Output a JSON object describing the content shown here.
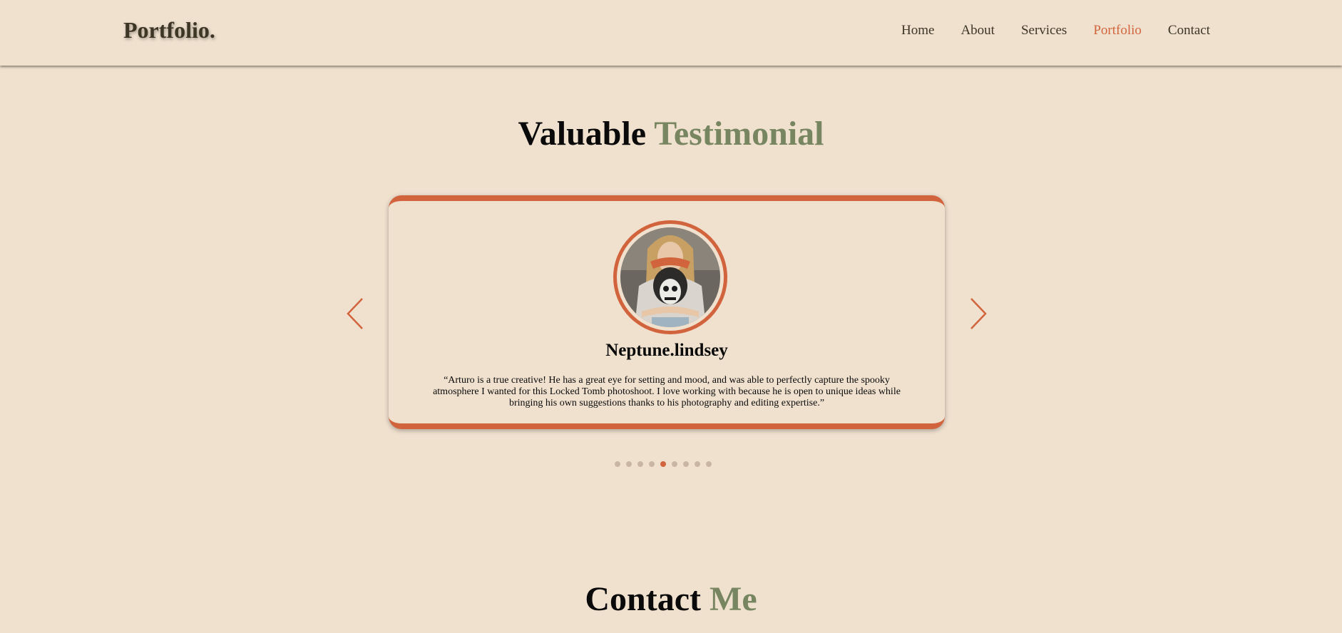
{
  "navbar": {
    "brand": "Portfolio.",
    "links": [
      {
        "label": "Home",
        "active": false
      },
      {
        "label": "About",
        "active": false
      },
      {
        "label": "Services",
        "active": false
      },
      {
        "label": "Portfolio",
        "active": true
      },
      {
        "label": "Contact",
        "active": false
      }
    ]
  },
  "testimonials": {
    "title_main": "Valuable",
    "title_accent": "Testimonial",
    "card": {
      "name": "Neptune.lindsey",
      "quote": "“Arturo is a true creative! He has a great eye for setting and mood, and was able to perfectly capture the spooky atmosphere I wanted for this Locked Tomb photoshoot. I love working with because he is open to unique ideas while bringing his own suggestions thanks to his photography and editing expertise.”"
    },
    "prev_icon": "chevron-left-icon",
    "next_icon": "chevron-right-icon",
    "pagination": {
      "total": 9,
      "active_index": 4
    }
  },
  "contact": {
    "title_main": "Contact",
    "title_accent": "Me"
  },
  "colors": {
    "background": "#f0e1cf",
    "accent": "#d2643d",
    "green": "#778660",
    "text_dark": "#3d3526"
  }
}
